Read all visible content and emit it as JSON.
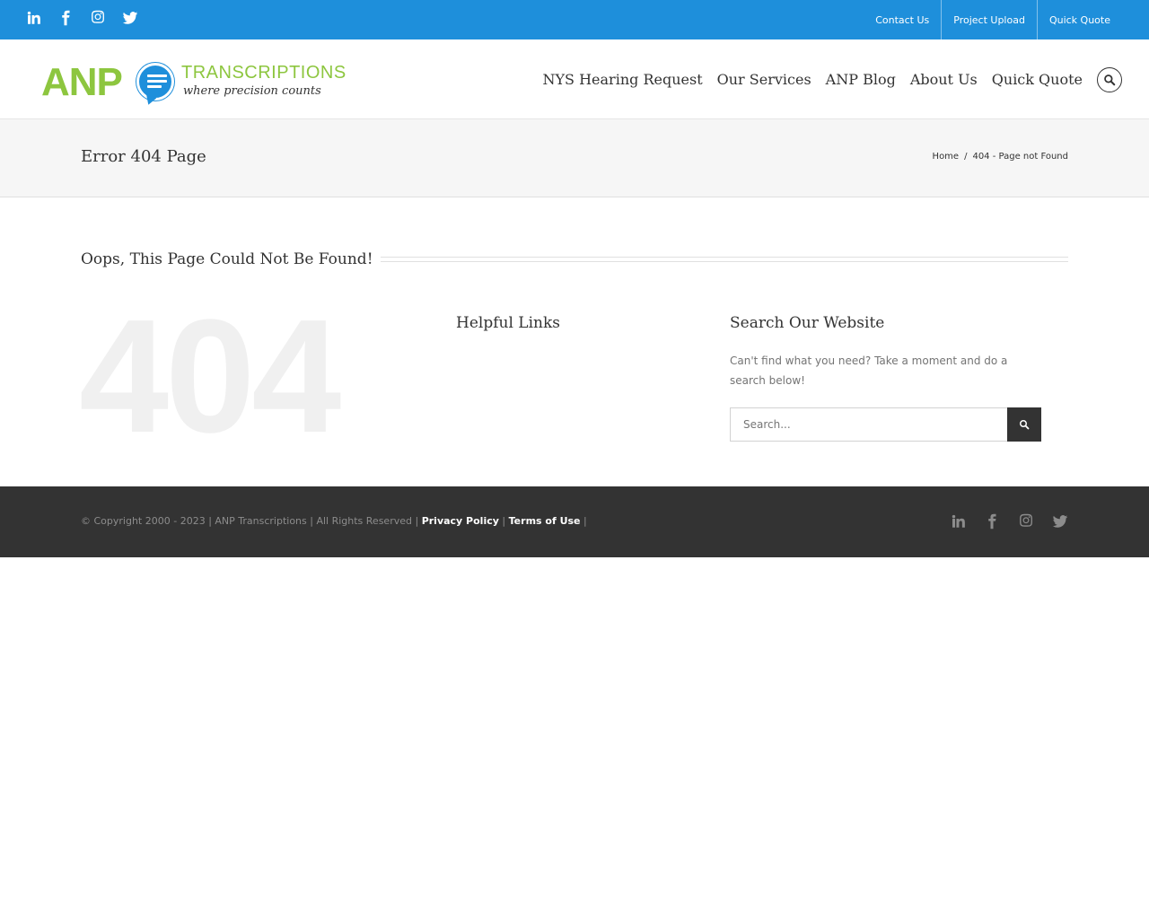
{
  "topbar": {
    "social": [
      {
        "icon": "linkedin-icon"
      },
      {
        "icon": "facebook-icon"
      },
      {
        "icon": "instagram-icon"
      },
      {
        "icon": "twitter-icon"
      }
    ],
    "links": [
      "Contact Us",
      "Project Upload",
      "Quick Quote"
    ],
    "bg_color": "#1e8fdb"
  },
  "logo": {
    "main": "ANP",
    "word": "TRANSCRIPTIONS",
    "tagline": "where precision counts"
  },
  "nav": {
    "items": [
      "NYS Hearing Request",
      "Our Services",
      "ANP Blog",
      "About Us",
      "Quick Quote"
    ]
  },
  "title_bar": {
    "title": "Error 404 Page",
    "breadcrumb": {
      "home": "Home",
      "separator": "/",
      "current": "404 - Page not Found"
    }
  },
  "content": {
    "heading": "Oops, This Page Could Not Be Found!",
    "big_code": "404",
    "helpful_title": "Helpful Links",
    "search_title": "Search Our Website",
    "search_desc": "Can't find what you need? Take a moment and do a search below!",
    "search_placeholder": "Search..."
  },
  "footer": {
    "copyright_text": "© Copyright 2000 - 2023 | ANP Transcriptions | All Rights Reserved |",
    "privacy": "Privacy Policy",
    "divider": "|",
    "terms": "Terms of Use",
    "trailing": "|",
    "bg_color": "#333333"
  }
}
